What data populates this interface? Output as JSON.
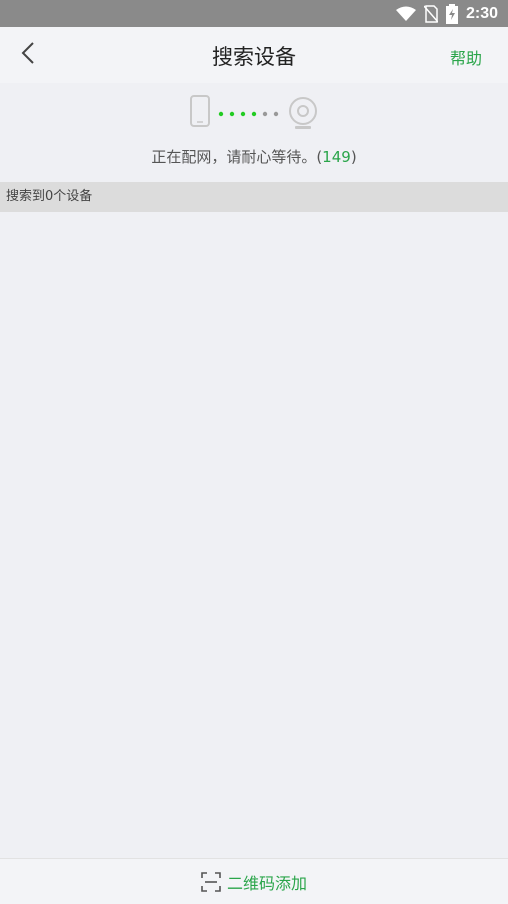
{
  "status_bar": {
    "time": "2:30",
    "icons": [
      "wifi-icon",
      "no-sim-icon",
      "battery-charging-icon"
    ]
  },
  "header": {
    "title": "搜索设备",
    "help_label": "帮助",
    "back_icon": "chevron-left-icon"
  },
  "pairing": {
    "status_text": "正在配网，请耐心等待。(",
    "countdown": "149",
    "closing": ")",
    "colors": {
      "active_dot": "#22cc22",
      "inactive_dot": "#999999"
    }
  },
  "results": {
    "label": "搜索到0个设备"
  },
  "bottom": {
    "qr_add_label": "二维码添加",
    "accent": "#2aa54a"
  }
}
